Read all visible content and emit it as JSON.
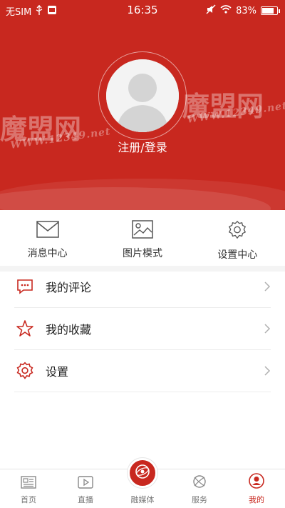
{
  "status_bar": {
    "carrier": "无SIM",
    "time": "16:35",
    "battery": "83%",
    "battery_level": 0.83
  },
  "profile": {
    "login_label": "注册/登录"
  },
  "watermark": {
    "brand": "魔盟网",
    "url": "WWW.12349.net"
  },
  "quick_actions": [
    {
      "label": "消息中心",
      "icon": "mail-icon"
    },
    {
      "label": "图片模式",
      "icon": "image-icon"
    },
    {
      "label": "设置中心",
      "icon": "gear-icon"
    }
  ],
  "menu": [
    {
      "label": "我的评论",
      "icon": "comment-icon"
    },
    {
      "label": "我的收藏",
      "icon": "star-icon"
    },
    {
      "label": "设置",
      "icon": "gear-icon"
    }
  ],
  "tabs": [
    {
      "label": "首页",
      "icon": "home-news-icon",
      "active": false
    },
    {
      "label": "直播",
      "icon": "play-icon",
      "active": false
    },
    {
      "label": "融媒体",
      "icon": "globe-icon",
      "active": false
    },
    {
      "label": "服务",
      "icon": "service-icon",
      "active": false
    },
    {
      "label": "我的",
      "icon": "user-icon",
      "active": true
    }
  ],
  "colors": {
    "brand_red": "#c8281f",
    "background": "#ffffff",
    "divider": "#ececec"
  }
}
